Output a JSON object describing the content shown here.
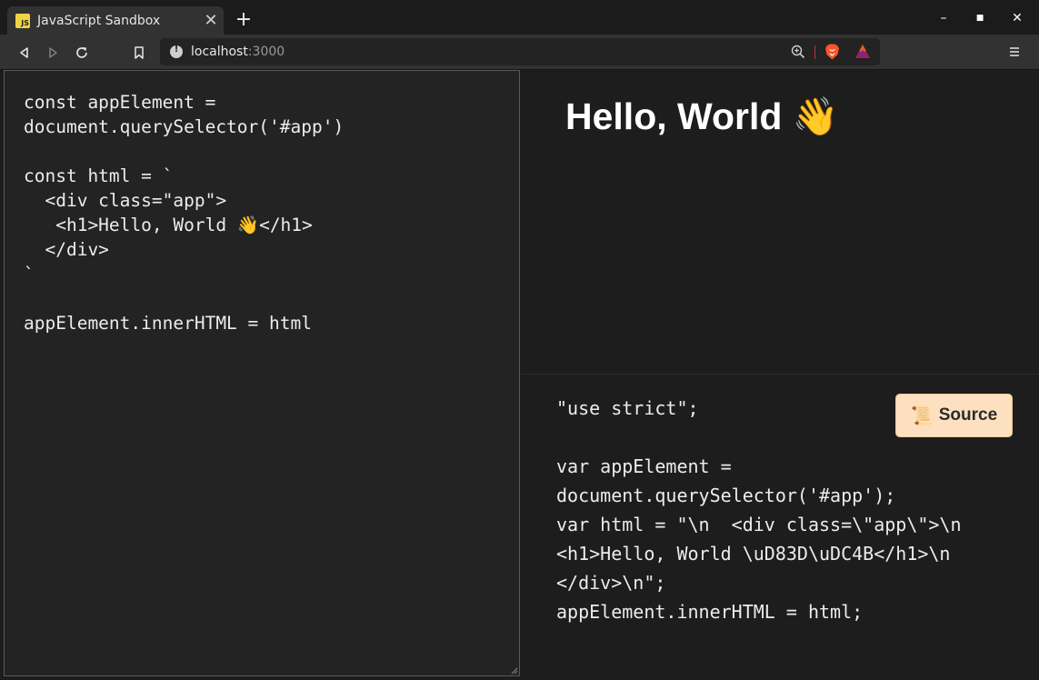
{
  "window": {
    "tab_title": "JavaScript Sandbox",
    "tab_favicon_text": "JS",
    "new_tab_label": "+",
    "minimize_label": "–",
    "maximize_label": "■",
    "close_label": "✕"
  },
  "toolbar": {
    "url_host": "localhost",
    "url_port": ":3000"
  },
  "editor": {
    "code": "const appElement =\ndocument.querySelector('#app')\n\nconst html = `\n  <div class=\"app\">\n   <h1>Hello, World 👋</h1>\n  </div>\n`\n\nappElement.innerHTML = html"
  },
  "preview": {
    "heading": "Hello, World 👋"
  },
  "compiled": {
    "code": "\"use strict\";\n\nvar appElement =\ndocument.querySelector('#app');\nvar html = \"\\n  <div class=\\\"app\\\">\\n\n<h1>Hello, World \\uD83D\\uDC4B</h1>\\n\n</div>\\n\";\nappElement.innerHTML = html;",
    "source_button": "Source",
    "source_icon": "📜"
  },
  "icons": {
    "back": "arrow-left-icon",
    "forward": "arrow-right-icon",
    "reload": "reload-icon",
    "bookmark": "bookmark-icon",
    "site_info": "info-icon",
    "zoom": "zoom-icon",
    "brave_shields": "brave-lion-icon",
    "brave_rewards": "rewards-triangle-icon",
    "menu": "hamburger-menu-icon"
  },
  "colors": {
    "background": "#1d1d1d",
    "editor_bg": "#232323",
    "toolbar_bg": "#323232",
    "source_button_bg": "#fde0c0",
    "brave_orange": "#fb542b"
  }
}
